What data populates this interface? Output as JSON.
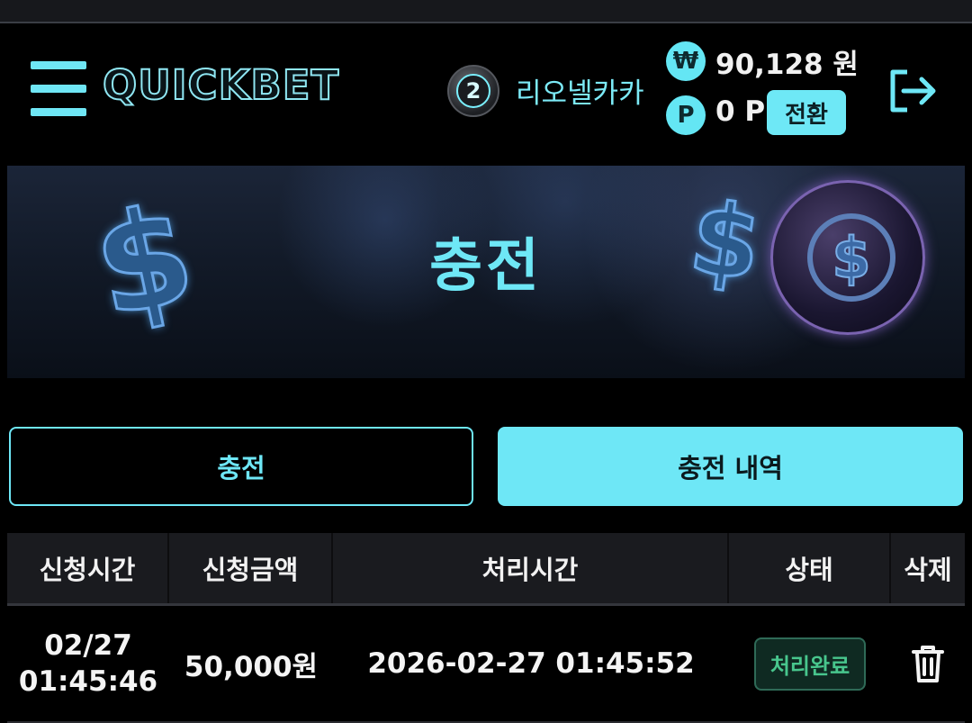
{
  "header": {
    "logo_text": "QUICKBET",
    "level": "2",
    "nickname": "리오넬카카",
    "money_icon": "won-icon",
    "money_icon_glyph": "₩",
    "money": "90,128 원",
    "point_icon": "point-icon",
    "point_icon_glyph": "P",
    "points": "0 P",
    "convert_label": "전환",
    "logout_icon": "logout-icon"
  },
  "banner": {
    "title": "충전"
  },
  "tabs": [
    {
      "label": "충전",
      "active": false
    },
    {
      "label": "충전 내역",
      "active": true
    }
  ],
  "table": {
    "headers": [
      "신청시간",
      "신청금액",
      "처리시간",
      "상태",
      "삭제"
    ],
    "rows": [
      {
        "date": "02/27",
        "time": "01:45:46",
        "amount": "50,000원",
        "processed": "2026-02-27 01:45:52",
        "status": "처리완료",
        "delete_icon": "trash-icon"
      }
    ]
  },
  "colors": {
    "accent": "#6ee7f6",
    "status_complete": "#48c68d",
    "background": "#000000"
  }
}
